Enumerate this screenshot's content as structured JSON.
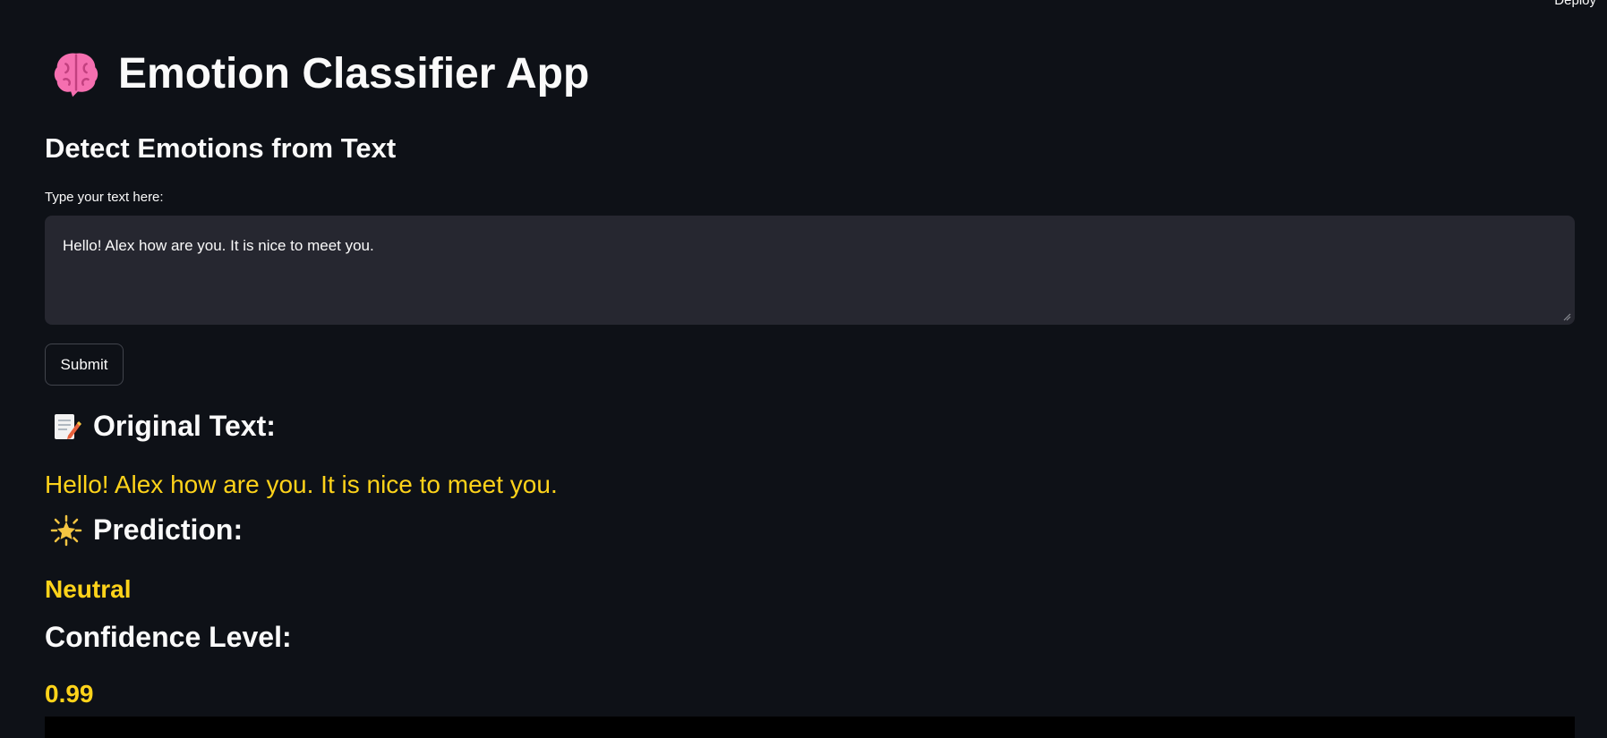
{
  "header": {
    "deploy_label": "Deploy"
  },
  "app": {
    "title": "Emotion Classifier App",
    "title_icon": "brain-icon",
    "subtitle": "Detect Emotions from Text"
  },
  "form": {
    "input_label": "Type your text here:",
    "input_value": "Hello! Alex how are you. It is nice to meet you.",
    "submit_label": "Submit"
  },
  "results": {
    "original_heading": "Original Text:",
    "original_icon": "memo-icon",
    "original_text": "Hello! Alex how are you. It is nice to meet you.",
    "prediction_heading": "Prediction:",
    "prediction_icon": "glowing-star-icon",
    "prediction_value": "Neutral",
    "confidence_heading": "Confidence Level:",
    "confidence_value": "0.99"
  },
  "colors": {
    "background": "#0e1117",
    "input_bg": "#262730",
    "accent": "#ffd31a",
    "text": "#fafafa"
  }
}
